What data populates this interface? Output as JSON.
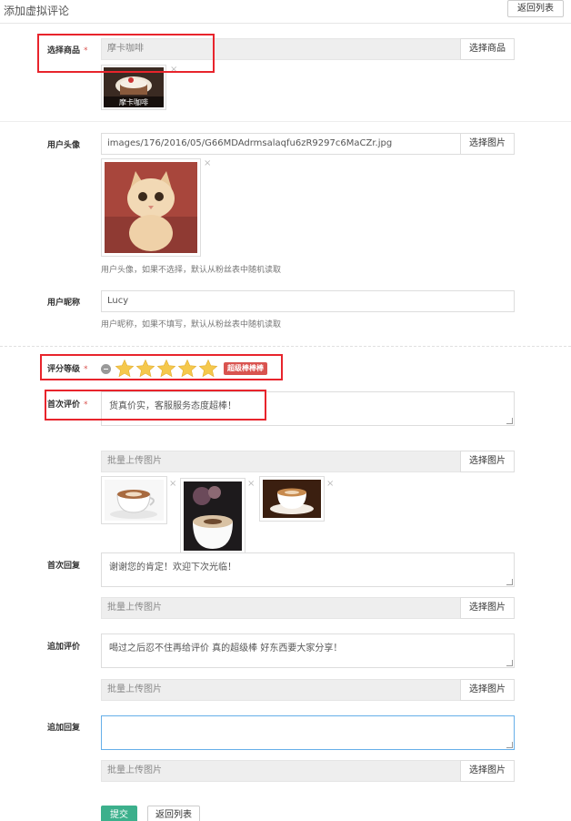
{
  "header": {
    "title": "添加虚拟评论",
    "back_label": "返回列表"
  },
  "goods": {
    "label": "选择商品",
    "required": "*",
    "value": "摩卡咖啡",
    "button": "选择商品",
    "thumb_caption": "摩卡咖啡"
  },
  "avatar": {
    "label": "用户头像",
    "value": "images/176/2016/05/G66MDAdrmsalaqfu6zR9297c6MaCZr.jpg",
    "button": "选择图片",
    "help": "用户头像，如果不选择，默认从粉丝表中随机读取"
  },
  "nickname": {
    "label": "用户昵称",
    "value": "Lucy",
    "help": "用户昵称，如果不填写，默认从粉丝表中随机读取"
  },
  "rating": {
    "label": "评分等级",
    "required": "*",
    "stars": 5,
    "max_stars": 5,
    "badge": "超级棒棒棒",
    "star_color": "#f5c84c"
  },
  "first_review": {
    "label": "首次评价",
    "required": "*",
    "value": "货真价实，客服服务态度超棒！",
    "upload_placeholder": "批量上传图片",
    "button": "选择图片"
  },
  "first_reply": {
    "label": "首次回复",
    "value": "谢谢您的肯定！欢迎下次光临！",
    "upload_placeholder": "批量上传图片",
    "button": "选择图片"
  },
  "append_review": {
    "label": "追加评价",
    "value": "喝过之后忍不住再给评价 真的超级棒 好东西要大家分享！",
    "upload_placeholder": "批量上传图片",
    "button": "选择图片"
  },
  "append_reply": {
    "label": "追加回复",
    "value": "",
    "upload_placeholder": "批量上传图片",
    "button": "选择图片"
  },
  "actions": {
    "submit": "提交",
    "back": "返回列表"
  },
  "icons": {
    "remove": "×"
  },
  "colors": {
    "submit": "#3cb08c",
    "badge": "#d9534f",
    "highlight": "#e8242c"
  }
}
